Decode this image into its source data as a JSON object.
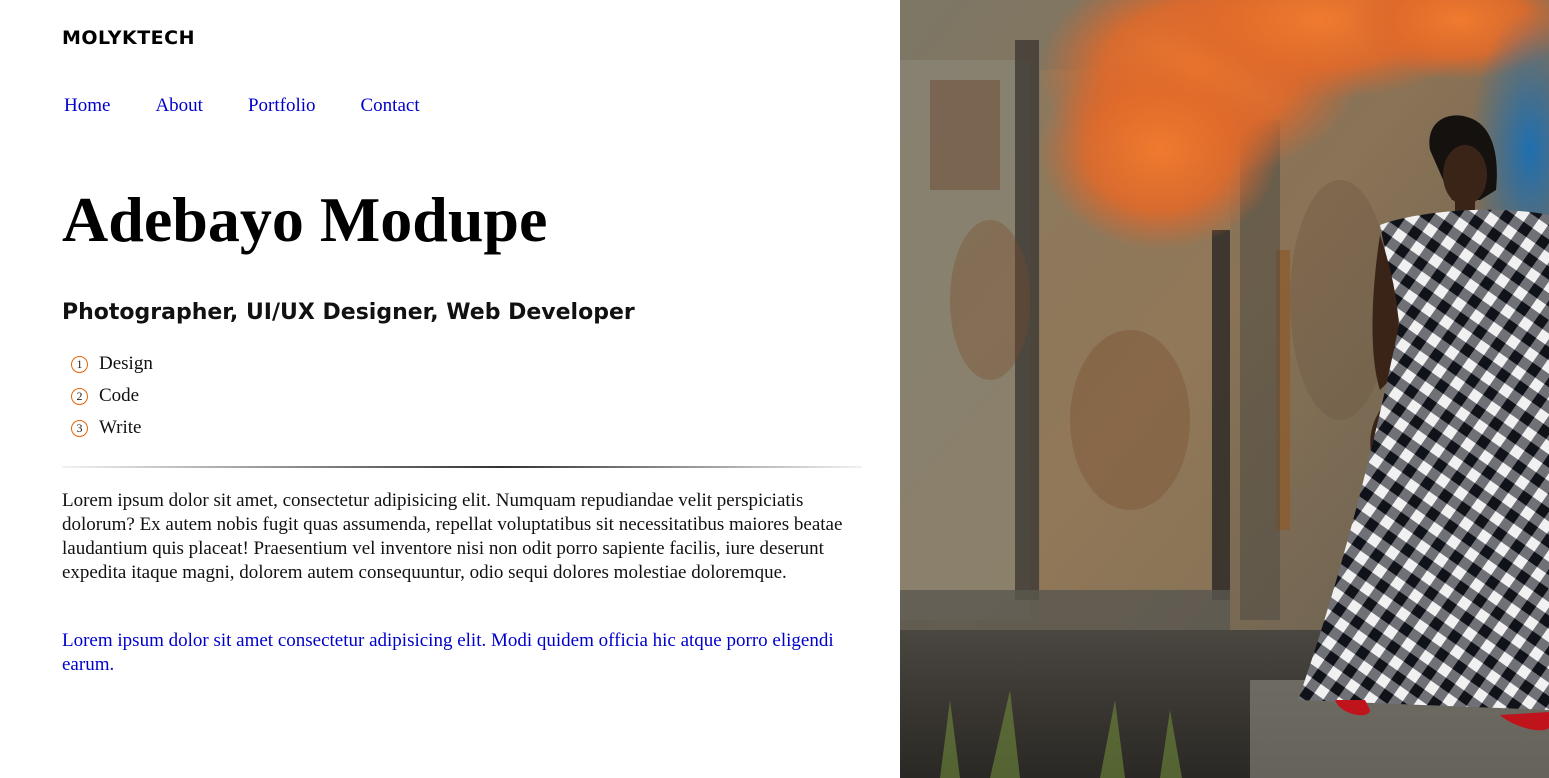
{
  "brand": "MOLYKTECH",
  "nav": {
    "home": "Home",
    "about": "About",
    "portfolio": "Portfolio",
    "contact": "Contact"
  },
  "hero": {
    "title": "Adebayo Modupe",
    "subtitle": "Photographer, UI/UX Designer, Web Developer"
  },
  "skills": [
    {
      "num": "1",
      "label": "Design"
    },
    {
      "num": "2",
      "label": "Code"
    },
    {
      "num": "3",
      "label": "Write"
    }
  ],
  "bio": "Lorem ipsum dolor sit amet, consectetur adipisicing elit. Numquam repudiandae velit perspiciatis dolorum? Ex autem nobis fugit quas assumenda, repellat voluptatibus sit necessitatibus maiores beatae laudantium quis placeat! Praesentium vel inventore nisi non odit porro sapiente facilis, iure deserunt expedita itaque magni, dolorem autem consequuntur, odio sequi dolores molestiae doloremque.",
  "bio_link": "Lorem ipsum dolor sit amet consectetur adipisicing elit. Modi quidem officia hic atque porro eligendi earum.",
  "colors": {
    "accent": "#e8620f",
    "link": "#0000cc",
    "smoke_orange": "#e8742a",
    "smoke_blue": "#1e6fb0"
  },
  "icons": {
    "skill_marker": "numbered-circle-icon"
  }
}
